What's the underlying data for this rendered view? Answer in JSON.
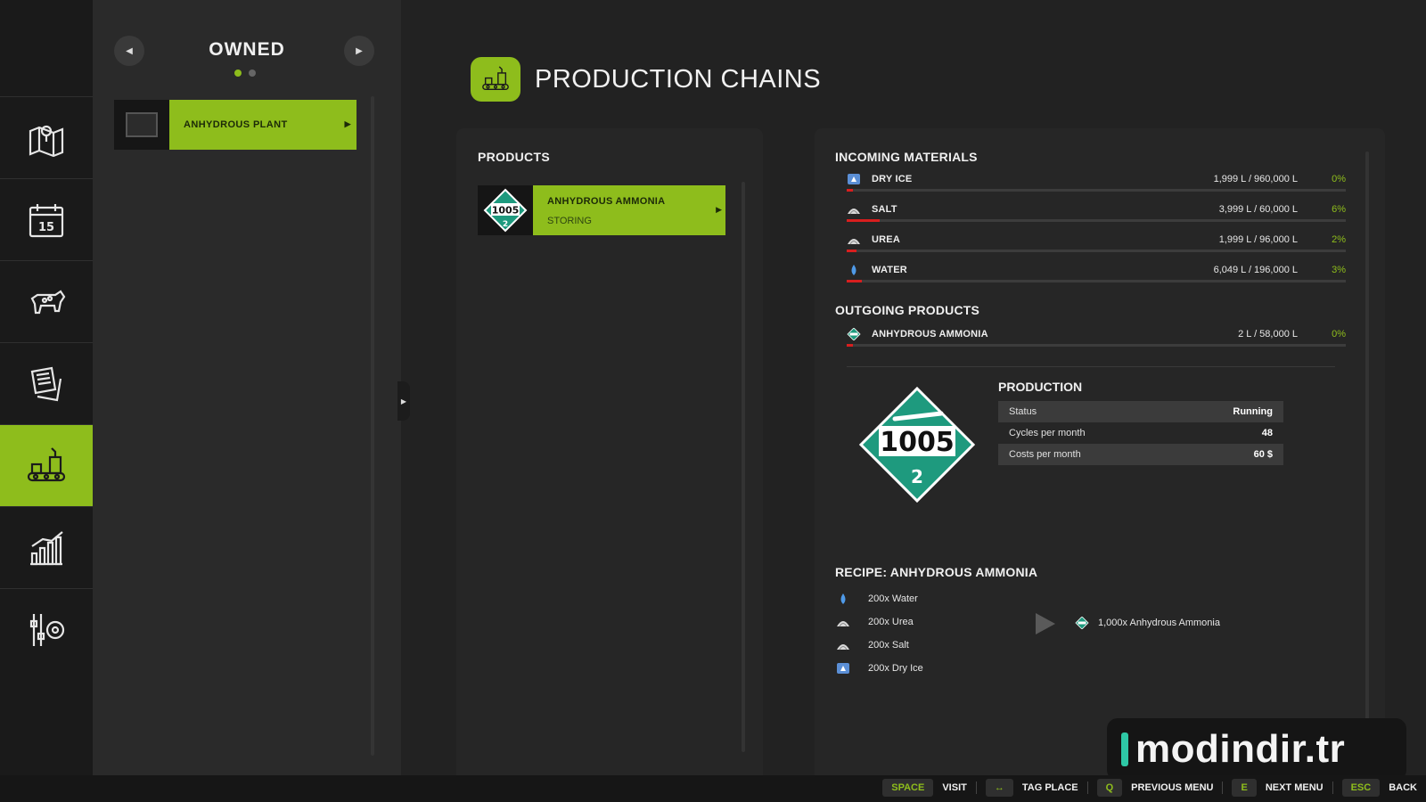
{
  "sidebar": {
    "items": [
      {
        "icon": "map-icon"
      },
      {
        "icon": "calendar-icon",
        "day": "15"
      },
      {
        "icon": "cow-icon"
      },
      {
        "icon": "contracts-icon"
      },
      {
        "icon": "production-icon",
        "active": true
      },
      {
        "icon": "statistics-icon"
      },
      {
        "icon": "settings-icon"
      }
    ]
  },
  "owned": {
    "title": "OWNED",
    "items": [
      {
        "label": "ANHYDROUS PLANT"
      }
    ]
  },
  "header": {
    "title": "PRODUCTION CHAINS"
  },
  "products": {
    "heading": "PRODUCTS",
    "items": [
      {
        "name": "ANHYDROUS AMMONIA",
        "status": "STORING",
        "placard_number": "1005",
        "placard_class": "2"
      }
    ]
  },
  "incoming": {
    "heading": "INCOMING MATERIALS",
    "items": [
      {
        "name": "DRY ICE",
        "amount": "1,999 L / 960,000 L",
        "percent": "0%",
        "fill": 0.01,
        "icon": "dry-ice-icon"
      },
      {
        "name": "SALT",
        "amount": "3,999 L / 60,000 L",
        "percent": "6%",
        "fill": 0.066,
        "icon": "salt-icon"
      },
      {
        "name": "UREA",
        "amount": "1,999 L / 96,000 L",
        "percent": "2%",
        "fill": 0.02,
        "icon": "urea-icon"
      },
      {
        "name": "WATER",
        "amount": "6,049 L / 196,000 L",
        "percent": "3%",
        "fill": 0.03,
        "icon": "water-icon"
      }
    ]
  },
  "outgoing": {
    "heading": "OUTGOING PRODUCTS",
    "items": [
      {
        "name": "ANHYDROUS AMMONIA",
        "amount": "2 L / 58,000 L",
        "percent": "0%",
        "fill": 0.005,
        "icon": "ammonia-icon"
      }
    ]
  },
  "production": {
    "heading": "PRODUCTION",
    "placard_number": "1005",
    "placard_class": "2",
    "stats": [
      {
        "label": "Status",
        "value": "Running"
      },
      {
        "label": "Cycles per month",
        "value": "48"
      },
      {
        "label": "Costs per month",
        "value": "60 $"
      }
    ]
  },
  "recipe": {
    "heading": "RECIPE: ANHYDROUS AMMONIA",
    "inputs": [
      {
        "text": "200x Water",
        "icon": "water-icon"
      },
      {
        "text": "200x Urea",
        "icon": "urea-icon"
      },
      {
        "text": "200x Salt",
        "icon": "salt-icon"
      },
      {
        "text": "200x Dry Ice",
        "icon": "dry-ice-icon"
      }
    ],
    "output": {
      "text": "1,000x Anhydrous Ammonia",
      "icon": "ammonia-icon"
    }
  },
  "watermark": {
    "text": "modindir.tr"
  },
  "hints": [
    {
      "key": "SPACE",
      "label": "VISIT"
    },
    {
      "key": "↔",
      "label": "TAG PLACE"
    },
    {
      "key": "Q",
      "label": "PREVIOUS MENU"
    },
    {
      "key": "E",
      "label": "NEXT MENU"
    },
    {
      "key": "ESC",
      "label": "BACK"
    }
  ],
  "colors": {
    "accent": "#8ebd1c",
    "bar_fill": "#d81e1e",
    "placard": "#1e9a7e"
  }
}
